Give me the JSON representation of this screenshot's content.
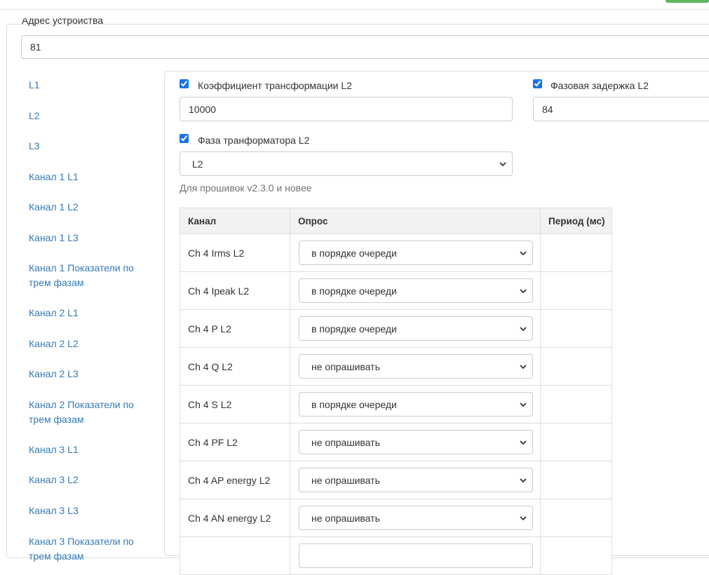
{
  "device_address": {
    "label": "Адрес устройства",
    "value": "81"
  },
  "nav": {
    "items": [
      {
        "label": "L1"
      },
      {
        "label": "L2"
      },
      {
        "label": "L3"
      },
      {
        "label": "Канал 1 L1"
      },
      {
        "label": "Канал 1 L2"
      },
      {
        "label": "Канал 1 L3"
      },
      {
        "label": "Канал 1 Показатели по трем фазам"
      },
      {
        "label": "Канал 2 L1"
      },
      {
        "label": "Канал 2 L2"
      },
      {
        "label": "Канал 2 L3"
      },
      {
        "label": "Канал 2 Показатели по трем фазам"
      },
      {
        "label": "Канал 3 L1"
      },
      {
        "label": "Канал 3 L2"
      },
      {
        "label": "Канал 3 L3"
      },
      {
        "label": "Канал 3 Показатели по трем фазам"
      }
    ]
  },
  "form": {
    "ratio": {
      "label": "Коэффициент трансформации L2",
      "value": "10000",
      "checked": true
    },
    "delay": {
      "label": "Фазовая задержка L2",
      "value": "84",
      "checked": true
    },
    "phase": {
      "label": "Фаза транформатора L2",
      "value": "L2",
      "checked": true
    },
    "help": "Для прошивок v2.3.0 и новее"
  },
  "table": {
    "headers": {
      "channel": "Канал",
      "poll": "Опрос",
      "period": "Период (мс)"
    },
    "rows": [
      {
        "channel": "Ch 4 Irms L2",
        "poll": "в порядке очереди",
        "period": ""
      },
      {
        "channel": "Ch 4 Ipeak L2",
        "poll": "в порядке очереди",
        "period": ""
      },
      {
        "channel": "Ch 4 P L2",
        "poll": "в порядке очереди",
        "period": ""
      },
      {
        "channel": "Ch 4 Q L2",
        "poll": "не опрашивать",
        "period": ""
      },
      {
        "channel": "Ch 4 S L2",
        "poll": "в порядке очереди",
        "period": ""
      },
      {
        "channel": "Ch 4 PF L2",
        "poll": "не опрашивать",
        "period": ""
      },
      {
        "channel": "Ch 4 AP energy L2",
        "poll": "не опрашивать",
        "period": ""
      },
      {
        "channel": "Ch 4 AN energy L2",
        "poll": "не опрашивать",
        "period": ""
      },
      {
        "channel": "",
        "poll": "",
        "period": ""
      }
    ]
  }
}
